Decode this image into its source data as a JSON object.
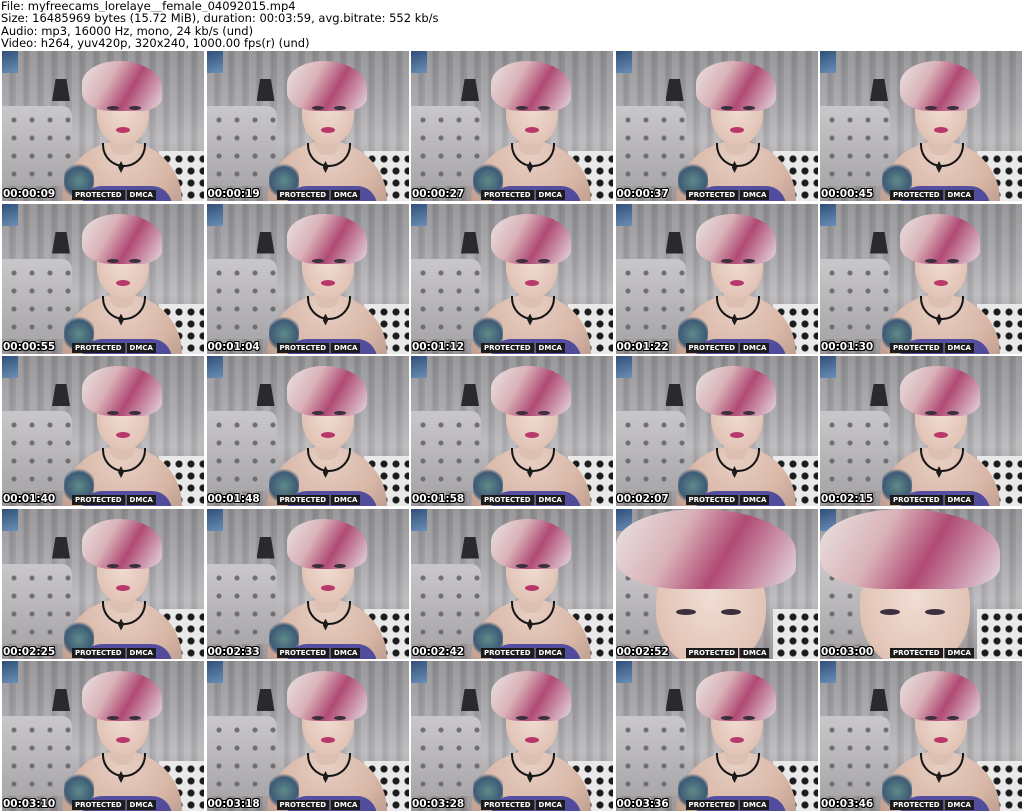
{
  "header": {
    "file_line": "File: myfreecams_lorelaye__female_04092015.mp4",
    "size_line": "Size: 16485969 bytes (15.72 MiB), duration: 00:03:59, avg.bitrate: 552 kb/s",
    "audio_line": "Audio: mp3, 16000 Hz, mono, 24 kb/s (und)",
    "video_line": "Video: h264, yuv420p, 320x240, 1000.00 fps(r) (und)"
  },
  "watermark": {
    "left": "PROTECTED",
    "right": "DMCA"
  },
  "thumbnails": [
    {
      "time": "00:00:09"
    },
    {
      "time": "00:00:19"
    },
    {
      "time": "00:00:27"
    },
    {
      "time": "00:00:37"
    },
    {
      "time": "00:00:45"
    },
    {
      "time": "00:00:55"
    },
    {
      "time": "00:01:04"
    },
    {
      "time": "00:01:12"
    },
    {
      "time": "00:01:22"
    },
    {
      "time": "00:01:30"
    },
    {
      "time": "00:01:40"
    },
    {
      "time": "00:01:48"
    },
    {
      "time": "00:01:58"
    },
    {
      "time": "00:02:07"
    },
    {
      "time": "00:02:15"
    },
    {
      "time": "00:02:25"
    },
    {
      "time": "00:02:33"
    },
    {
      "time": "00:02:42"
    },
    {
      "time": "00:02:52"
    },
    {
      "time": "00:03:00"
    },
    {
      "time": "00:03:10"
    },
    {
      "time": "00:03:18"
    },
    {
      "time": "00:03:28"
    },
    {
      "time": "00:03:36"
    },
    {
      "time": "00:03:46"
    }
  ]
}
